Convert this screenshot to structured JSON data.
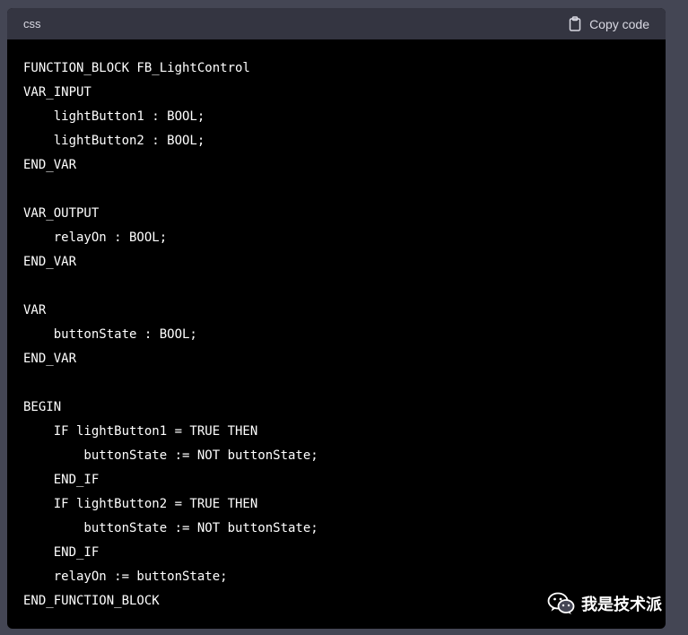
{
  "code_block": {
    "language": "css",
    "copy_label": "Copy code",
    "copy_icon": "clipboard-icon",
    "lines": [
      "FUNCTION_BLOCK FB_LightControl",
      "VAR_INPUT",
      "    lightButton1 : BOOL;",
      "    lightButton2 : BOOL;",
      "END_VAR",
      "",
      "VAR_OUTPUT",
      "    relayOn : BOOL;",
      "END_VAR",
      "",
      "VAR",
      "    buttonState : BOOL;",
      "END_VAR",
      "",
      "BEGIN",
      "    IF lightButton1 = TRUE THEN",
      "        buttonState := NOT buttonState;",
      "    END_IF",
      "    IF lightButton2 = TRUE THEN",
      "        buttonState := NOT buttonState;",
      "    END_IF",
      "    relayOn := buttonState;",
      "END_FUNCTION_BLOCK"
    ]
  },
  "watermark": {
    "text": "我是技术派",
    "icon": "wechat-icon"
  },
  "colors": {
    "page_bg": "#444654",
    "header_bg": "#343541",
    "code_bg": "#000000",
    "code_text": "#ffffff",
    "header_text": "#d9d9e3"
  }
}
